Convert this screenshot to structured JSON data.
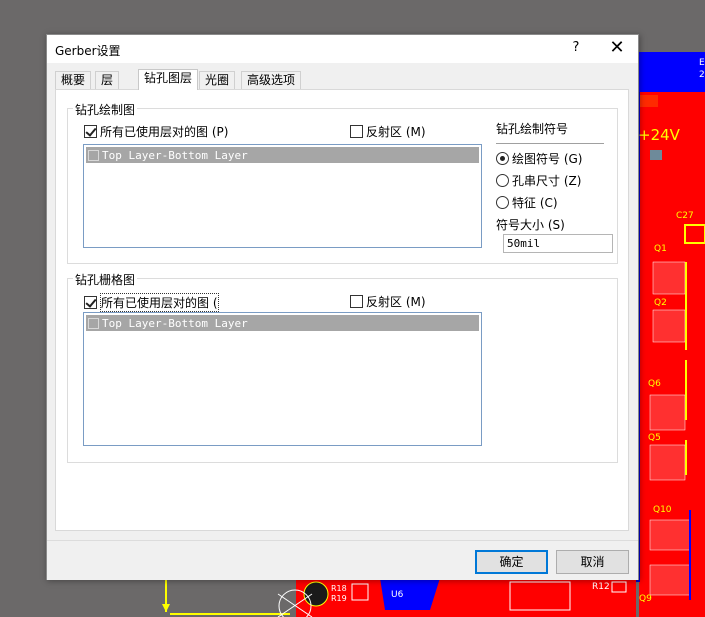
{
  "dialog": {
    "title": "Gerber设置",
    "help_label": "?",
    "close_label": "✕"
  },
  "tabs": [
    {
      "label": "概要"
    },
    {
      "label": "层"
    },
    {
      "label": "钻孔图层"
    },
    {
      "label": "光圈"
    },
    {
      "label": "高级选项"
    }
  ],
  "drill_drawing": {
    "title": "钻孔绘制图",
    "all_used_label": "所有已使用层对的图 (P)",
    "mirror_label": "反射区 (M)",
    "layer_pair": "Top Layer-Bottom Layer",
    "symbol_title": "钻孔绘制符号",
    "symbol_options": [
      {
        "label": "绘图符号 (G)",
        "checked": true
      },
      {
        "label": "孔串尺寸 (Z)",
        "checked": false
      },
      {
        "label": "特征 (C)",
        "checked": false
      }
    ],
    "size_label": "符号大小 (S)",
    "size_value": "50mil"
  },
  "drill_guide": {
    "title": "钻孔栅格图",
    "all_used_label": "所有已使用层对的图 (",
    "mirror_label": "反射区 (M)",
    "layer_pair": "Top Layer-Bottom Layer"
  },
  "buttons": {
    "ok": "确定",
    "cancel": "取消"
  },
  "pcb": {
    "labels": [
      "+24V",
      "C27",
      "Q1",
      "Q2",
      "Q6",
      "Q5",
      "Q10",
      "Q9",
      "U6",
      "R12",
      "R18",
      "R19",
      "E",
      "2"
    ]
  },
  "colors": {
    "pcb_red": "#ff0000",
    "pcb_blue": "#0000ff",
    "pcb_yellow": "#ffff00",
    "accent": "#0078d7"
  }
}
